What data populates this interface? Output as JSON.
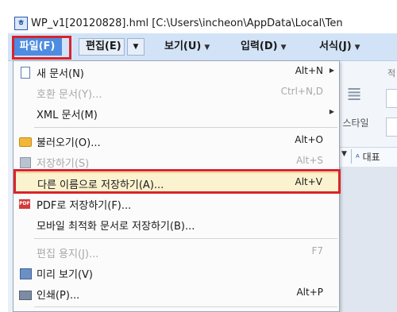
{
  "window": {
    "title": "WP_v1[20120828].hml  [C:\\Users\\incheon\\AppData\\Local\\Ten"
  },
  "menubar": {
    "file": "파일(F)",
    "edit": "편집(E)",
    "view": "보기(U)",
    "input": "입력(D)",
    "format": "서식(J)"
  },
  "toolbar": {
    "right_frag": "적",
    "style_label": "스타일",
    "style_value": "대표"
  },
  "file_menu": {
    "new": {
      "label": "새 문서(N)",
      "shortcut": "Alt+N"
    },
    "compat": {
      "label": "호환 문서(Y)...",
      "shortcut": "Ctrl+N,D"
    },
    "xml": {
      "label": "XML 문서(M)"
    },
    "open": {
      "label": "불러오기(O)...",
      "shortcut": "Alt+O"
    },
    "save": {
      "label": "저장하기(S)",
      "shortcut": "Alt+S"
    },
    "save_as": {
      "label": "다른 이름으로 저장하기(A)...",
      "shortcut": "Alt+V"
    },
    "save_pdf": {
      "label": "PDF로 저장하기(F)..."
    },
    "save_mobile": {
      "label": "모바일 최적화 문서로 저장하기(B)..."
    },
    "page_setup": {
      "label": "편집 용지(J)...",
      "shortcut": "F7"
    },
    "preview": {
      "label": "미리 보기(V)"
    },
    "print": {
      "label": "인쇄(P)...",
      "shortcut": "Alt+P"
    }
  },
  "icons": {
    "app": "hwp-app-icon",
    "pdf_text": "PDF"
  },
  "colors": {
    "highlight_box": "#d9242a",
    "active_menu": "#4d8ce0",
    "hover_row": "#fbf2cf"
  }
}
